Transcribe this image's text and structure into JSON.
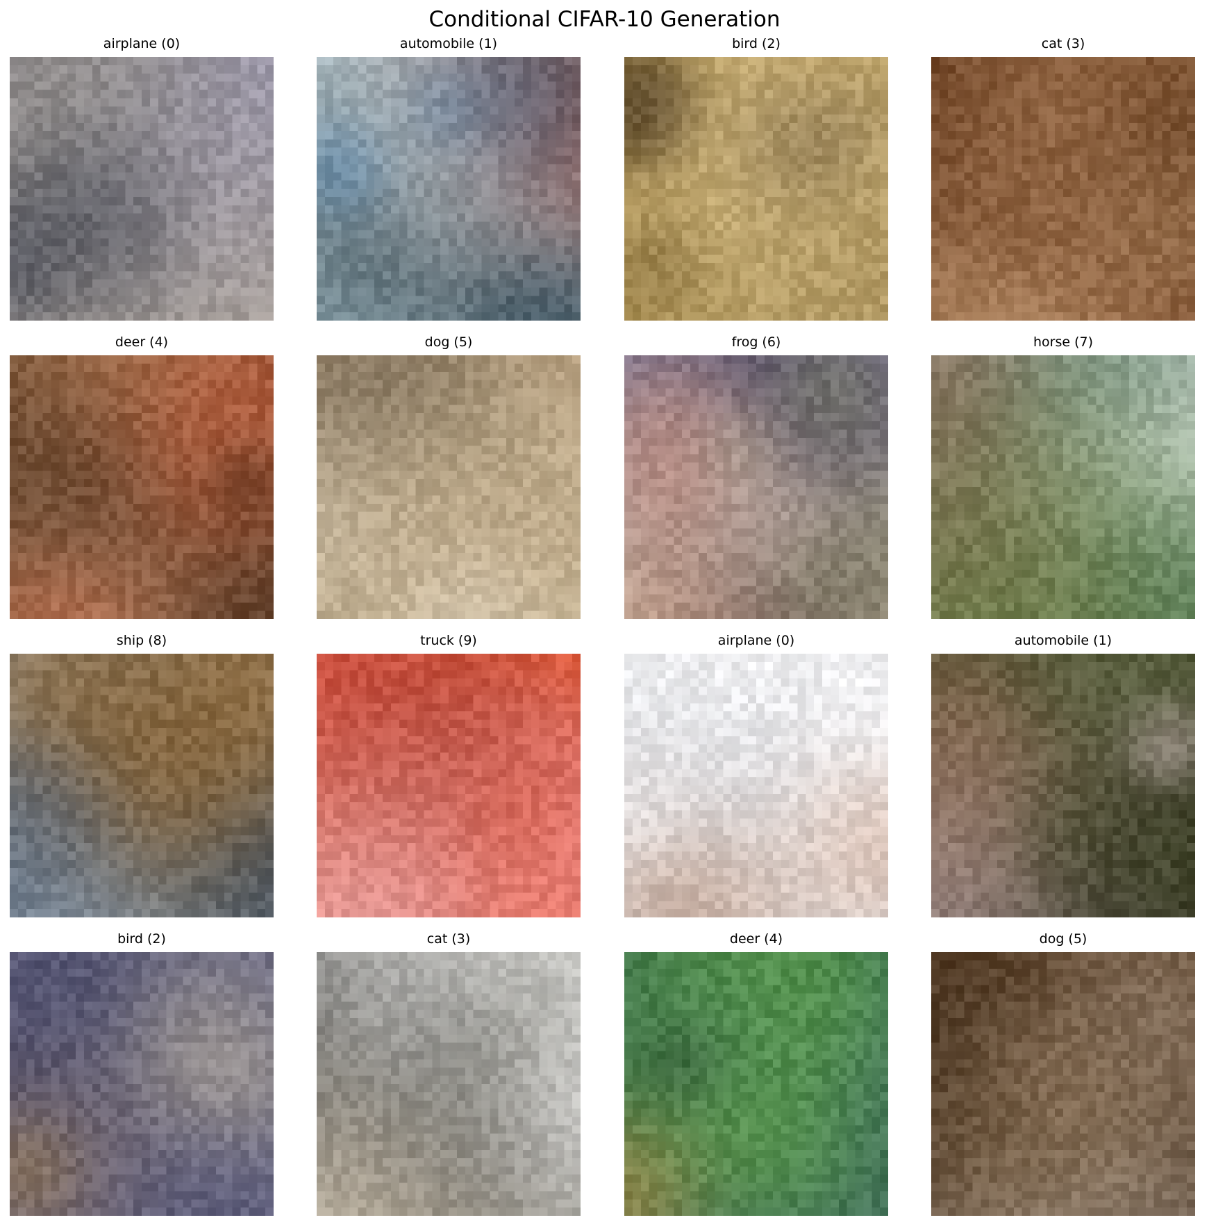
{
  "figure": {
    "title": "Conditional CIFAR-10 Generation"
  },
  "samples": [
    {
      "label": "airplane (0)",
      "subject": "airplane",
      "palette": [
        "#a39fb8",
        "#9a96ad",
        "#a8a09a",
        "#8f8b84",
        "#2a3a70",
        "#1c2438",
        "#c13a2a",
        "#ece6e0"
      ]
    },
    {
      "label": "automobile (1)",
      "subject": "automobile",
      "palette": [
        "#d6e8ee",
        "#e6f0f3",
        "#bcd4dd",
        "#5f93c1",
        "#3d6e9c",
        "#16303f",
        "#0c1f28",
        "#c24a3a"
      ]
    },
    {
      "label": "bird (2)",
      "subject": "bird",
      "palette": [
        "#b69a5a",
        "#c8ac70",
        "#a48a4e",
        "#8b7340",
        "#6b5530",
        "#d8c08a",
        "#3a2a18",
        "#a08a6e"
      ]
    },
    {
      "label": "cat (3)",
      "subject": "cat",
      "palette": [
        "#6a4023",
        "#5a3419",
        "#7e5030",
        "#3e2410",
        "#9a6e48",
        "#f6f3f0",
        "#c8a078",
        "#4a2c14"
      ]
    },
    {
      "label": "deer (4)",
      "subject": "deer",
      "palette": [
        "#6a4a30",
        "#4a3020",
        "#8a6040",
        "#a8805a",
        "#c89070",
        "#d8b090",
        "#3a2818",
        "#c06040"
      ]
    },
    {
      "label": "dog (5)",
      "subject": "dog",
      "palette": [
        "#b8a080",
        "#a08a68",
        "#d0c0a0",
        "#6a5a48",
        "#3a3028",
        "#c0404a",
        "#e8e0d0",
        "#8a7868"
      ]
    },
    {
      "label": "frog (6)",
      "subject": "frog",
      "palette": [
        "#7a7490",
        "#4a4458",
        "#c8bfa8",
        "#e8d8d0",
        "#a89a86",
        "#2a2430",
        "#c89080",
        "#8a9070"
      ]
    },
    {
      "label": "horse (7)",
      "subject": "horse",
      "palette": [
        "#f4f4f6",
        "#e8ecec",
        "#8cb87a",
        "#6aa058",
        "#4a7a40",
        "#a88060",
        "#6a4a30",
        "#3a6048"
      ]
    },
    {
      "label": "ship (8)",
      "subject": "ship",
      "palette": [
        "#8a9cb0",
        "#a8b8c6",
        "#c8d2da",
        "#6a7c90",
        "#4a5a70",
        "#1e2a38",
        "#e8b030",
        "#b07020"
      ]
    },
    {
      "label": "truck (9)",
      "subject": "truck",
      "palette": [
        "#f25a2a",
        "#ff6a30",
        "#d04020",
        "#e8a0b0",
        "#2a1418",
        "#6a1a20",
        "#c85050",
        "#f0c0c8"
      ]
    },
    {
      "label": "airplane (0)",
      "subject": "airplane",
      "palette": [
        "#f0f0f2",
        "#e4e6ea",
        "#d8dce2",
        "#1a1a28",
        "#8a4830",
        "#a0603a",
        "#6a3820",
        "#c89070"
      ]
    },
    {
      "label": "automobile (1)",
      "subject": "automobile",
      "palette": [
        "#4a5030",
        "#5a6040",
        "#3a3a28",
        "#e0c8d0",
        "#f0e0e8",
        "#c0a8b0",
        "#6a4a30",
        "#8a6040"
      ]
    },
    {
      "label": "bird (2)",
      "subject": "bird",
      "palette": [
        "#5a5a78",
        "#4a4a68",
        "#6a6a88",
        "#2a2030",
        "#c87040",
        "#e8d8a8",
        "#c8a050",
        "#8a6a50"
      ]
    },
    {
      "label": "cat (3)",
      "subject": "cat",
      "palette": [
        "#f6f6f6",
        "#ececec",
        "#a8a8a0",
        "#8a8a84",
        "#4a4a48",
        "#1a1a1a",
        "#c8b8a0",
        "#6a6a60"
      ]
    },
    {
      "label": "deer (4)",
      "subject": "deer",
      "palette": [
        "#3a6a58",
        "#4a7a60",
        "#2a5048",
        "#7ac850",
        "#5aa040",
        "#0a1a14",
        "#c89040",
        "#6a5040"
      ]
    },
    {
      "label": "dog (5)",
      "subject": "dog",
      "palette": [
        "#5a4028",
        "#4a3420",
        "#3a2818",
        "#2a1830",
        "#e8e0d8",
        "#a89080",
        "#8a7050",
        "#c0b0a0"
      ]
    }
  ]
}
